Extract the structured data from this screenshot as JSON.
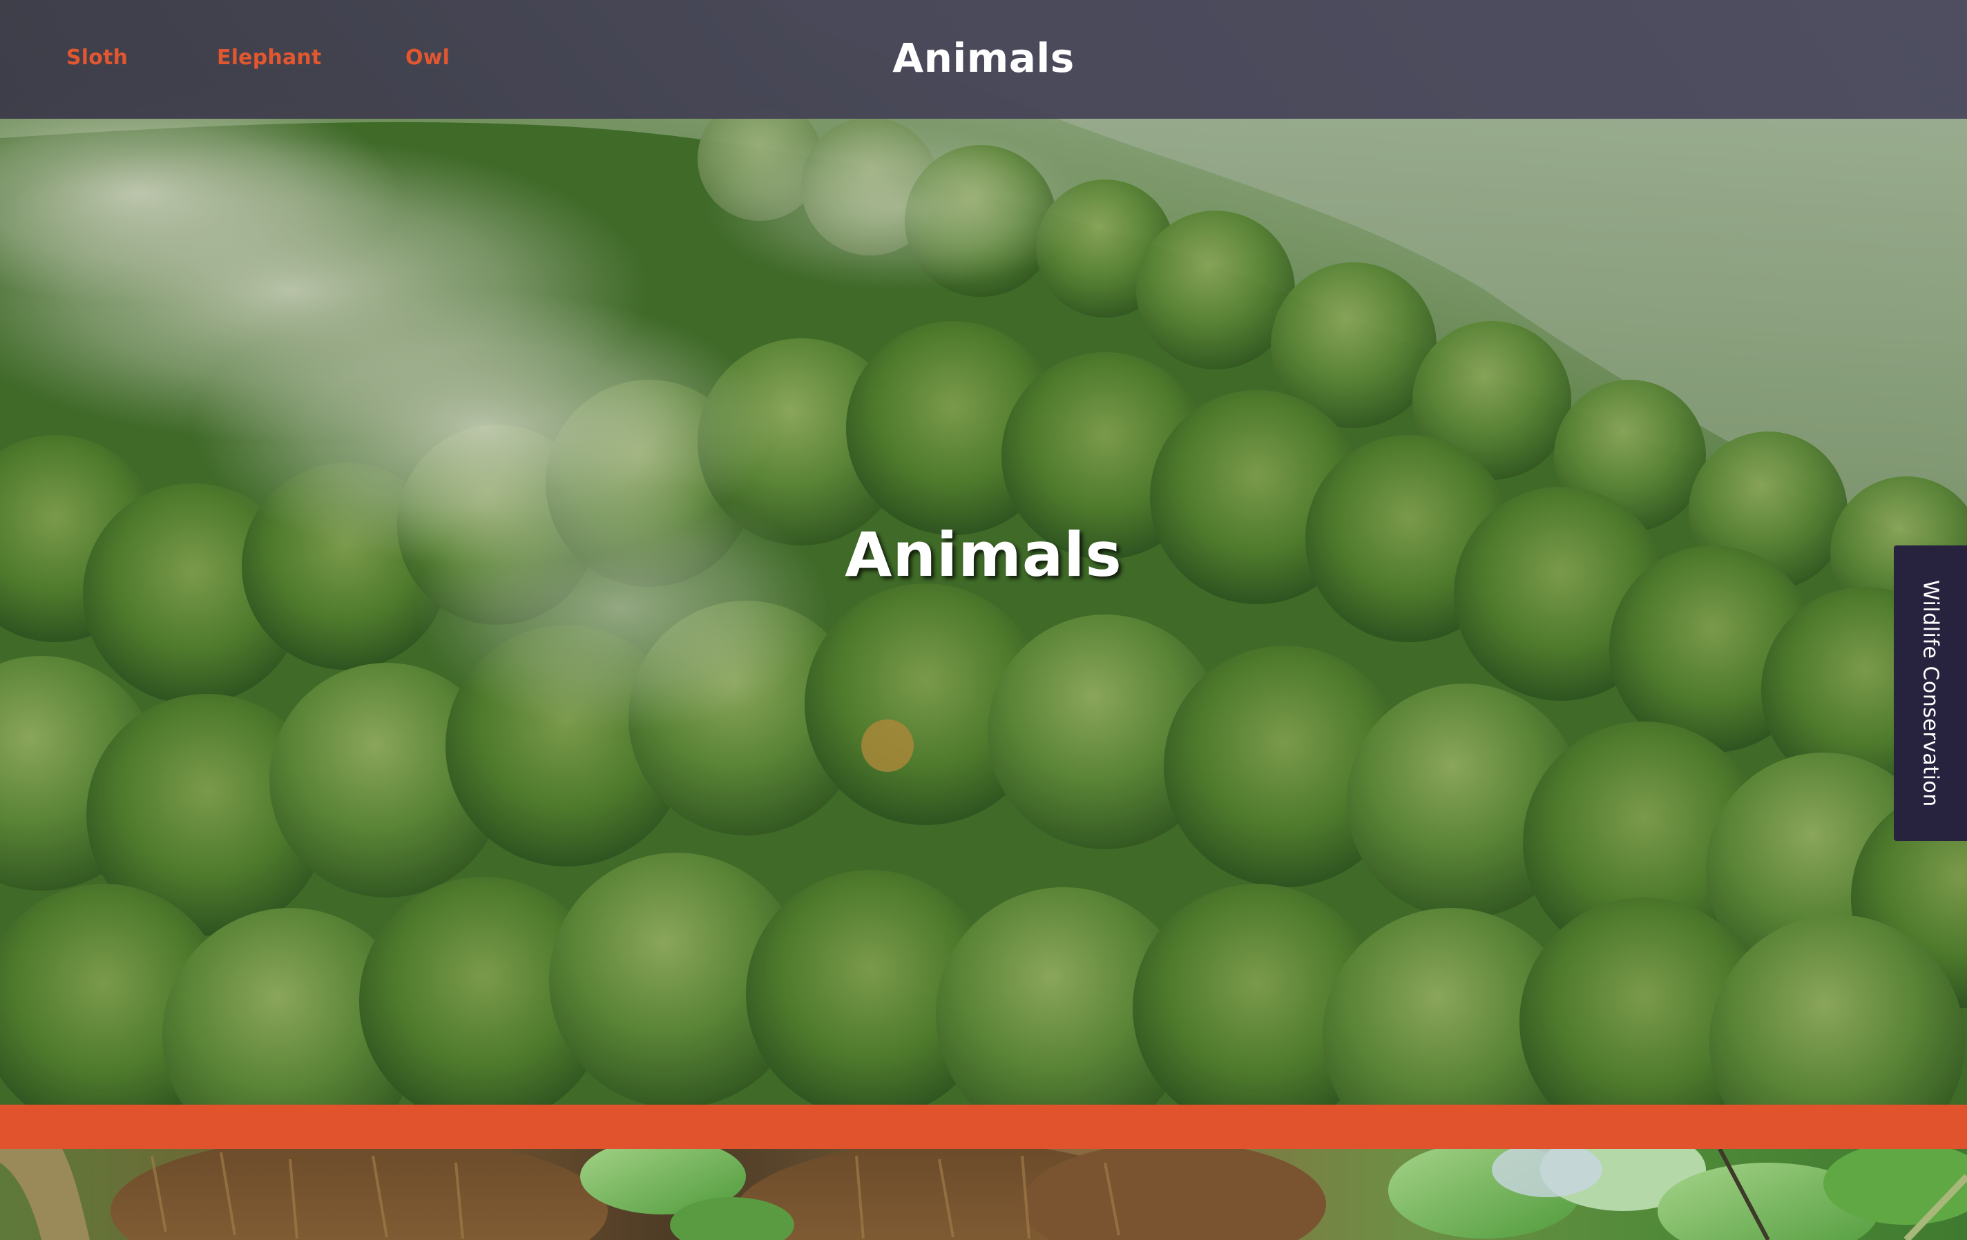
{
  "nav": {
    "links": [
      "Sloth",
      "Elephant",
      "Owl"
    ],
    "title": "Animals"
  },
  "hero": {
    "title": "Animals",
    "background_image": "misty-rainforest-canopy"
  },
  "side_tab": {
    "label": "Wildlife Conservation"
  },
  "sloth_section": {
    "background_image": "sloth-in-tree"
  },
  "colors": {
    "nav_background": "#45435a",
    "nav_link": "#e2572f",
    "divider": "#e0532d",
    "side_tab": "#27233f",
    "text_light": "#ffffff"
  }
}
